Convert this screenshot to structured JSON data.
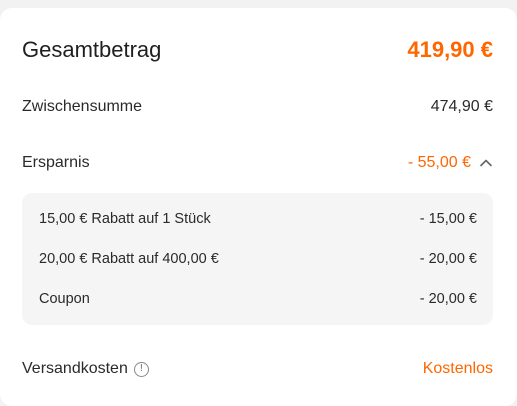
{
  "summary": {
    "total_label": "Gesamtbetrag",
    "total_value": "419,90 €",
    "subtotal_label": "Zwischensumme",
    "subtotal_value": "474,90 €",
    "savings_label": "Ersparnis",
    "savings_value": "- 55,00 €",
    "discounts": [
      {
        "label": "15,00 € Rabatt auf 1 Stück",
        "value": "- 15,00 €"
      },
      {
        "label": "20,00 € Rabatt auf 400,00 €",
        "value": "- 20,00 €"
      },
      {
        "label": "Coupon",
        "value": "- 20,00 €"
      }
    ],
    "shipping_label": "Versandkosten",
    "shipping_value": "Kostenlos"
  },
  "icons": {
    "chevron": "chevron-up-icon",
    "info": "info-icon"
  },
  "colors": {
    "accent": "#ff6600",
    "background": "#f2f2f3",
    "card": "#ffffff",
    "discount_box": "#f5f5f6"
  }
}
